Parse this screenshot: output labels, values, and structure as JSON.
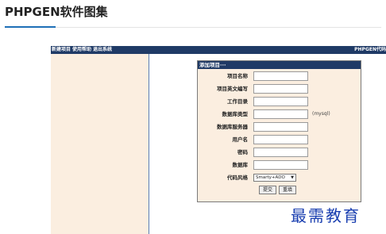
{
  "page": {
    "title": "PHPGEN软件图集"
  },
  "app": {
    "menu": [
      "新建项目",
      "使用帮助",
      "退出系统"
    ],
    "brand": "PHPGEN代码"
  },
  "form": {
    "header": "添加项目···",
    "fields": [
      {
        "label": "项目名称",
        "value": ""
      },
      {
        "label": "项目英文编写",
        "value": ""
      },
      {
        "label": "工作目录",
        "value": ""
      },
      {
        "label": "数据库类型",
        "value": "",
        "hint": "(mysql)"
      },
      {
        "label": "数据库服务器",
        "value": ""
      },
      {
        "label": "用户名",
        "value": ""
      },
      {
        "label": "密码",
        "value": ""
      },
      {
        "label": "数据库",
        "value": ""
      }
    ],
    "style_field": {
      "label": "代码风格",
      "selected": "Smarty+ADO"
    },
    "submit_label": "提交",
    "reset_label": "重填"
  },
  "watermark": "最需教育"
}
